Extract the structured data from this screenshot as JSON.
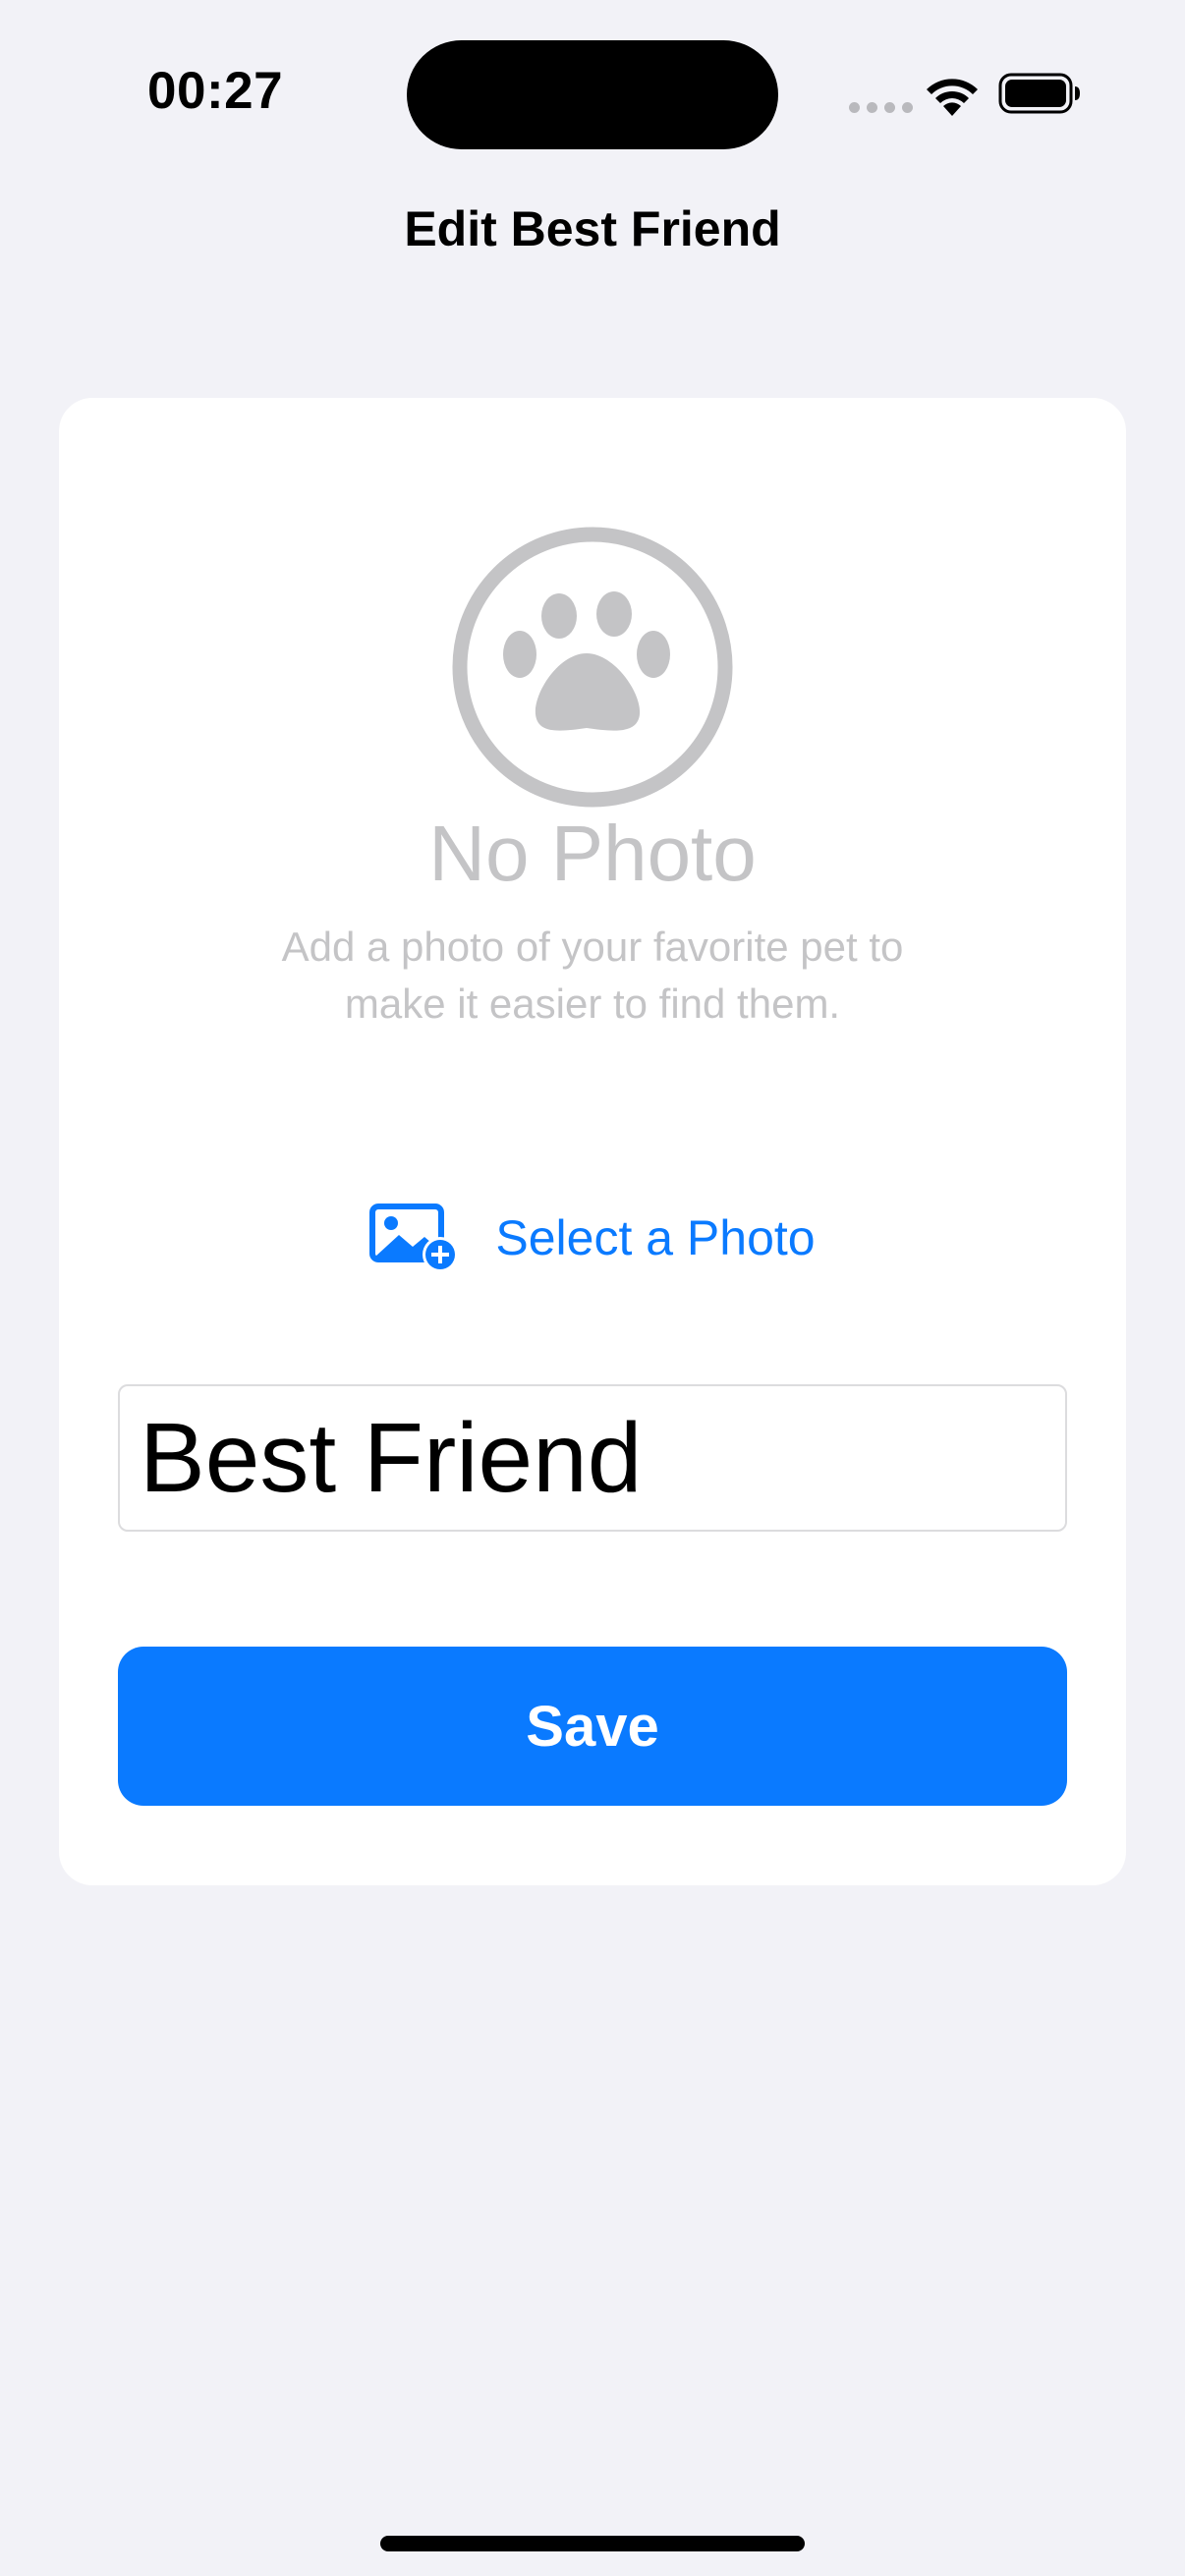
{
  "status_bar": {
    "time": "00:27"
  },
  "nav": {
    "title": "Edit Best Friend"
  },
  "photo": {
    "icon": "pawprint-circle-icon",
    "title": "No Photo",
    "description": "Add a photo of your favorite pet to make it easier to find them.",
    "placeholder_color": "#c4c4c6"
  },
  "select_photo": {
    "icon": "photo-badge-plus-icon",
    "label": "Select a Photo"
  },
  "name_field": {
    "value": "Best Friend"
  },
  "save": {
    "label": "Save"
  },
  "colors": {
    "background": "#f2f2f7",
    "accent": "#0a7aff",
    "card": "#ffffff"
  }
}
